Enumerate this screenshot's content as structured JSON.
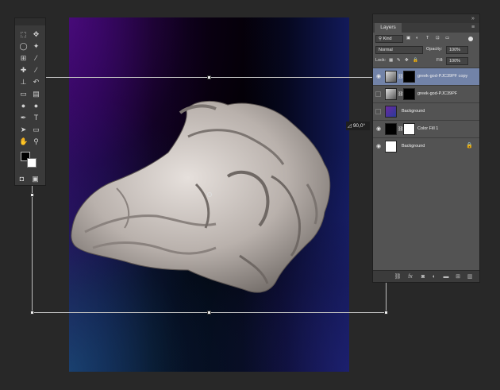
{
  "app": {
    "background": "#282828"
  },
  "transform": {
    "angle_readout": "90,0°",
    "angle_icon": "angle-icon"
  },
  "layers_panel": {
    "tab_label": "Layers",
    "filter": {
      "kind_label": "Kind"
    },
    "blend_mode": "Normal",
    "opacity_label": "Opacity:",
    "opacity_value": "100%",
    "lock_label": "Lock:",
    "fill_label": "Fill:",
    "fill_value": "100%",
    "layers": [
      {
        "name": "greek-god-PJC39PF copy",
        "visible": true,
        "selected": true
      },
      {
        "name": "greek-god-PJC39PF",
        "visible": false,
        "selected": false
      },
      {
        "name": "Background",
        "visible": false,
        "selected": false
      },
      {
        "name": "Color Fill 1",
        "visible": true,
        "selected": false
      },
      {
        "name": "Background",
        "visible": true,
        "selected": false,
        "locked": true
      }
    ],
    "footer_icons": [
      "link-icon",
      "fx-icon",
      "mask-icon",
      "adjustment-icon",
      "folder-icon",
      "new-layer-icon",
      "trash-icon"
    ]
  },
  "colors": {
    "selected_row": "#7283a8",
    "panel": "#535353",
    "statue": "#c9c2bd"
  }
}
